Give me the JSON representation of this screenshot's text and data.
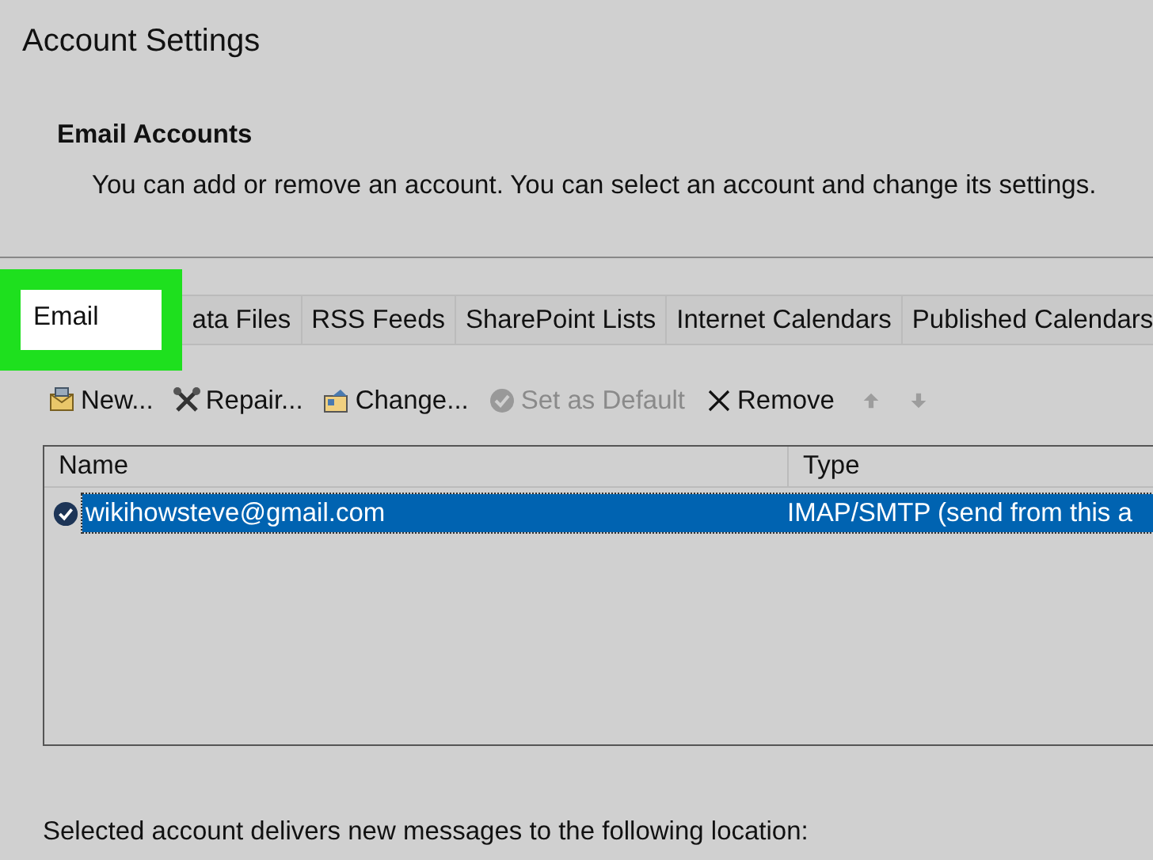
{
  "window": {
    "title": "Account Settings"
  },
  "section": {
    "heading": "Email Accounts",
    "description": "You can add or remove an account. You can select an account and change its settings."
  },
  "tabs": [
    {
      "label": "Email",
      "selected": true,
      "highlighted": true
    },
    {
      "label": "ata Files",
      "selected": false,
      "highlighted": false
    },
    {
      "label": "RSS Feeds",
      "selected": false,
      "highlighted": false
    },
    {
      "label": "SharePoint Lists",
      "selected": false,
      "highlighted": false
    },
    {
      "label": "Internet Calendars",
      "selected": false,
      "highlighted": false
    },
    {
      "label": "Published Calendars",
      "selected": false,
      "highlighted": false
    }
  ],
  "toolbar": [
    {
      "kind": "new",
      "label": "New...",
      "disabled": false
    },
    {
      "kind": "repair",
      "label": "Repair...",
      "disabled": false
    },
    {
      "kind": "change",
      "label": "Change...",
      "disabled": false
    },
    {
      "kind": "default",
      "label": "Set as Default",
      "disabled": true
    },
    {
      "kind": "remove",
      "label": "Remove",
      "disabled": false
    },
    {
      "kind": "up",
      "disabled": true
    },
    {
      "kind": "down",
      "disabled": true
    }
  ],
  "accounts": {
    "columns": [
      "Name",
      "Type"
    ],
    "rows": [
      {
        "name": "wikihowsteve@gmail.com",
        "type": "IMAP/SMTP (send from this a",
        "default": true,
        "selected": true
      }
    ]
  },
  "footer": "Selected account delivers new messages to the following location:"
}
